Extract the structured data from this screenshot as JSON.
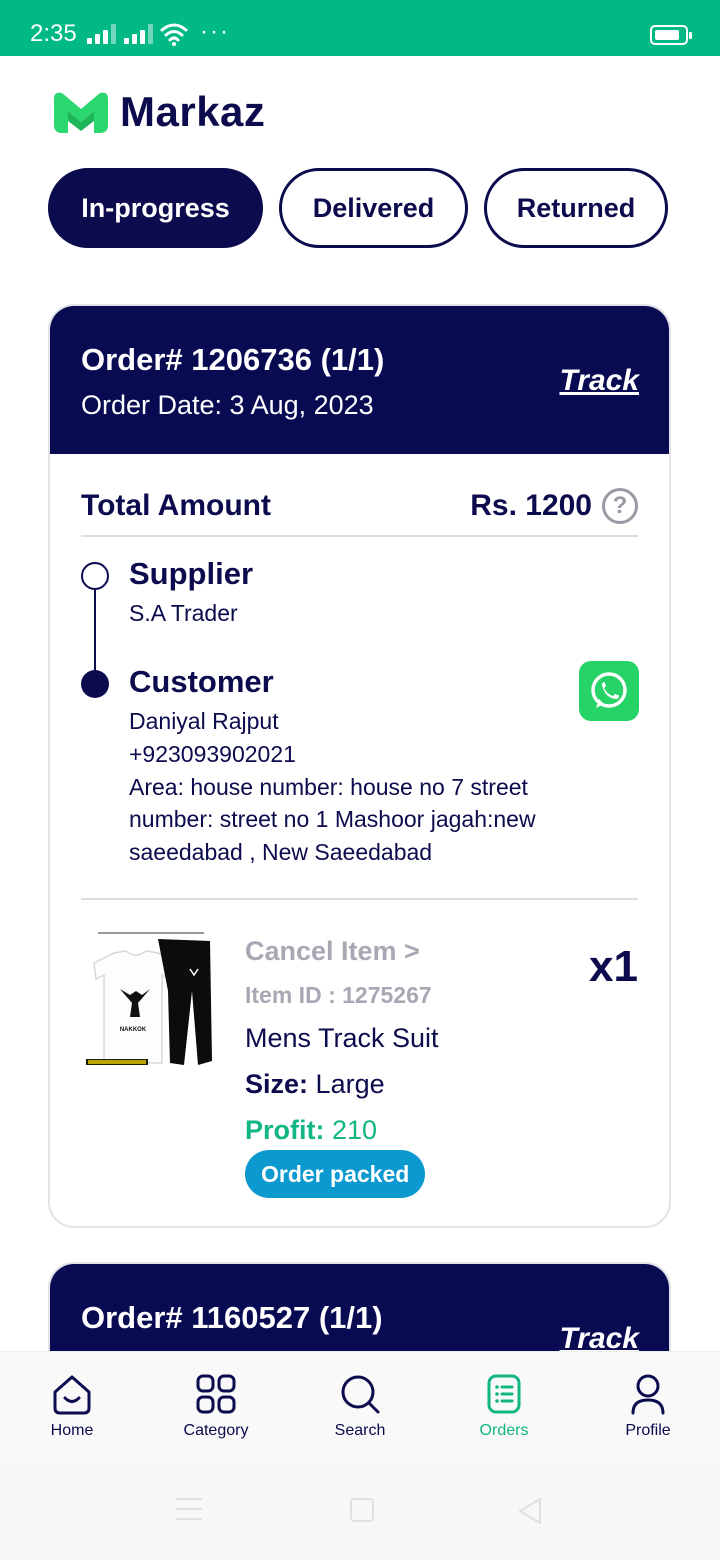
{
  "status_bar": {
    "time": "2:35",
    "more": "···"
  },
  "logo": {
    "name": "Markaz"
  },
  "tabs": [
    {
      "label": "In-progress",
      "active": true
    },
    {
      "label": "Delivered",
      "active": false
    },
    {
      "label": "Returned",
      "active": false
    }
  ],
  "orders": [
    {
      "order_no": "Order# 1206736 (1/1)",
      "order_date": "Order Date: 3 Aug, 2023",
      "track_label": "Track",
      "total_label": "Total Amount",
      "total_value": "Rs. 1200",
      "help_icon": "?",
      "supplier_title": "Supplier",
      "supplier_name": "S.A Trader",
      "customer_title": "Customer",
      "customer_name": "Daniyal Rajput",
      "customer_phone": "+923093902021",
      "customer_area_line1": "Area:  house number: house no 7 street",
      "customer_area_line2": "number: street no 1  Mashoor jagah:new",
      "customer_area_line3": "saeedabad , New Saeedabad",
      "cancel_label": "Cancel Item   >",
      "item_id": "Item ID : 1275267",
      "quantity": "x1",
      "product_name": "Mens Track Suit",
      "size_label": "Size:",
      "size_value": "Large",
      "profit_label": "Profit:",
      "profit_value": "210",
      "status_badge": "Order packed",
      "image_caption": "NAKKOK"
    },
    {
      "order_no": "Order# 1160527 (1/1)",
      "track_label": "Track"
    }
  ],
  "bottom_nav": [
    {
      "label": "Home",
      "icon": "home-icon"
    },
    {
      "label": "Category",
      "icon": "category-grid-icon"
    },
    {
      "label": "Search",
      "icon": "search-icon"
    },
    {
      "label": "Orders",
      "icon": "orders-receipt-icon",
      "active": true
    },
    {
      "label": "Profile",
      "icon": "profile-icon"
    }
  ],
  "colors": {
    "status_bar": "#00b984",
    "navy": "#0b0b4d",
    "card_header": "#080a52",
    "green": "#12b584",
    "badge_blue": "#0b99cf",
    "whatsapp": "#25d366"
  }
}
